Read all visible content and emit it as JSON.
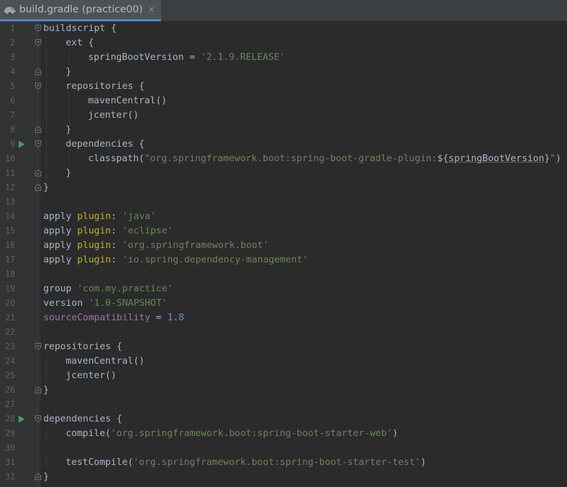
{
  "tab": {
    "title": "build.gradle (practice00)",
    "close": "×"
  },
  "lines": [
    {
      "n": "1",
      "fold": "open",
      "segs": [
        [
          "p",
          "buildscript {"
        ]
      ]
    },
    {
      "n": "2",
      "fold": "open",
      "indent": 1,
      "segs": [
        [
          "p",
          "ext {"
        ]
      ]
    },
    {
      "n": "3",
      "indent": 2,
      "segs": [
        [
          "p",
          "springBootVersion = "
        ],
        [
          "s",
          "'2.1.9.RELEASE'"
        ]
      ]
    },
    {
      "n": "4",
      "fold": "close",
      "indent": 1,
      "segs": [
        [
          "p",
          "}"
        ]
      ]
    },
    {
      "n": "5",
      "fold": "open",
      "indent": 1,
      "segs": [
        [
          "p",
          "repositories {"
        ]
      ]
    },
    {
      "n": "6",
      "indent": 2,
      "segs": [
        [
          "p",
          "mavenCentral()"
        ]
      ]
    },
    {
      "n": "7",
      "indent": 2,
      "segs": [
        [
          "p",
          "jcenter()"
        ]
      ]
    },
    {
      "n": "8",
      "fold": "close",
      "indent": 1,
      "segs": [
        [
          "p",
          "}"
        ]
      ]
    },
    {
      "n": "9",
      "run": true,
      "fold": "open",
      "indent": 1,
      "segs": [
        [
          "p",
          "dependencies {"
        ]
      ]
    },
    {
      "n": "10",
      "indent": 2,
      "segs": [
        [
          "p",
          "classpath("
        ],
        [
          "s",
          "\"org.springframework.boot:spring-boot-gradle-plugin:"
        ],
        [
          "p",
          "${"
        ],
        [
          "i",
          "springBootVersion"
        ],
        [
          "p",
          "}"
        ],
        [
          "s",
          "\""
        ],
        [
          "p",
          ")"
        ]
      ]
    },
    {
      "n": "11",
      "fold": "close",
      "indent": 1,
      "segs": [
        [
          "p",
          "}"
        ]
      ]
    },
    {
      "n": "12",
      "fold": "close",
      "segs": [
        [
          "p",
          "}"
        ]
      ]
    },
    {
      "n": "13",
      "segs": []
    },
    {
      "n": "14",
      "segs": [
        [
          "p",
          "apply "
        ],
        [
          "k",
          "plugin"
        ],
        [
          "p",
          ": "
        ],
        [
          "s",
          "'java'"
        ]
      ]
    },
    {
      "n": "15",
      "segs": [
        [
          "p",
          "apply "
        ],
        [
          "k",
          "plugin"
        ],
        [
          "p",
          ": "
        ],
        [
          "s",
          "'eclipse'"
        ]
      ]
    },
    {
      "n": "16",
      "segs": [
        [
          "p",
          "apply "
        ],
        [
          "k",
          "plugin"
        ],
        [
          "p",
          ": "
        ],
        [
          "s",
          "'org.springframework.boot'"
        ]
      ]
    },
    {
      "n": "17",
      "segs": [
        [
          "p",
          "apply "
        ],
        [
          "k",
          "plugin"
        ],
        [
          "p",
          ": "
        ],
        [
          "s",
          "'io.spring.dependency-management'"
        ]
      ]
    },
    {
      "n": "18",
      "segs": []
    },
    {
      "n": "19",
      "segs": [
        [
          "p",
          "group "
        ],
        [
          "s",
          "'com.my.practice'"
        ]
      ]
    },
    {
      "n": "20",
      "segs": [
        [
          "p",
          "version "
        ],
        [
          "s",
          "'1.0-SNAPSHOT'"
        ]
      ]
    },
    {
      "n": "21",
      "segs": [
        [
          "v",
          "sourceCompatibility"
        ],
        [
          "p",
          " = "
        ],
        [
          "d",
          "1.8"
        ]
      ]
    },
    {
      "n": "22",
      "segs": []
    },
    {
      "n": "23",
      "fold": "open",
      "segs": [
        [
          "p",
          "repositories {"
        ]
      ]
    },
    {
      "n": "24",
      "indent": 1,
      "segs": [
        [
          "p",
          "mavenCentral()"
        ]
      ]
    },
    {
      "n": "25",
      "indent": 1,
      "segs": [
        [
          "p",
          "jcenter()"
        ]
      ]
    },
    {
      "n": "26",
      "fold": "close",
      "segs": [
        [
          "p",
          "}"
        ]
      ]
    },
    {
      "n": "27",
      "segs": []
    },
    {
      "n": "28",
      "run": true,
      "fold": "open",
      "segs": [
        [
          "p",
          "dependencies {"
        ]
      ]
    },
    {
      "n": "29",
      "indent": 1,
      "segs": [
        [
          "p",
          "compile("
        ],
        [
          "s",
          "'org.springframework.boot:spring-boot-starter-web'"
        ],
        [
          "p",
          ")"
        ]
      ]
    },
    {
      "n": "30",
      "segs": []
    },
    {
      "n": "31",
      "indent": 1,
      "segs": [
        [
          "p",
          "testCompile("
        ],
        [
          "s",
          "'org.springframework.boot:spring-boot-starter-test'"
        ],
        [
          "p",
          ")"
        ]
      ]
    },
    {
      "n": "32",
      "fold": "close",
      "segs": [
        [
          "p",
          "}"
        ]
      ]
    }
  ]
}
